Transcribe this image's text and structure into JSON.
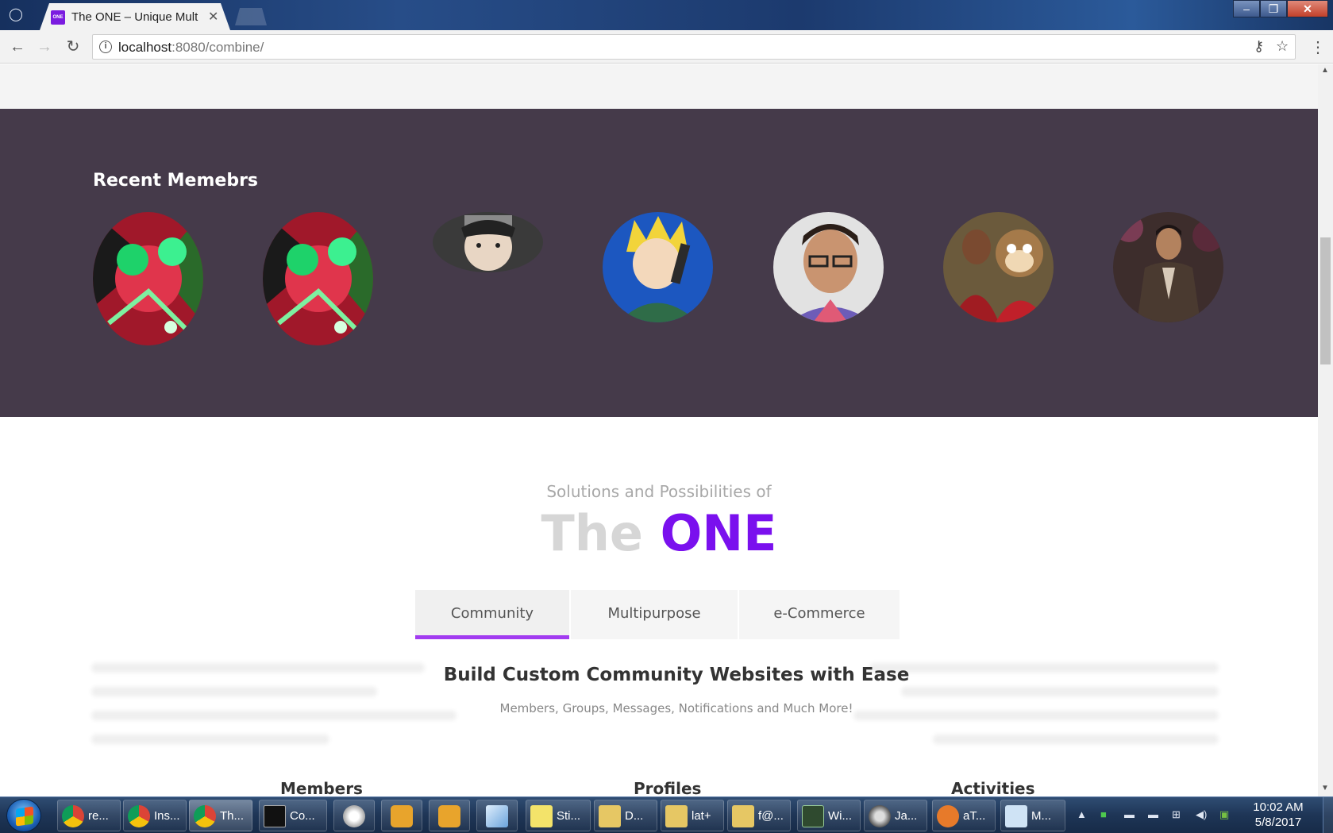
{
  "browser": {
    "tab_title": "The ONE – Unique Multip",
    "favicon_text": "ONE",
    "url_host": "localhost",
    "url_path": ":8080/combine/"
  },
  "members_section": {
    "title": "Recent Memebrs",
    "background": "#453a4a"
  },
  "solutions_section": {
    "subtitle": "Solutions and Possibilities of",
    "heading_the": "The",
    "heading_one": "ONE",
    "accent_color": "#7a10ee",
    "tabs": [
      {
        "label": "Community",
        "active": true
      },
      {
        "label": "Multipurpose",
        "active": false
      },
      {
        "label": "e-Commerce",
        "active": false
      }
    ],
    "feature_title": "Build Custom Community Websites with Ease",
    "feature_subtitle": "Members, Groups, Messages, Notifications and Much More!",
    "columns": [
      "Members",
      "Profiles",
      "Activities"
    ]
  },
  "taskbar": {
    "items": [
      {
        "label": "re...",
        "icon": "chrome-icon"
      },
      {
        "label": "Ins...",
        "icon": "chrome-icon"
      },
      {
        "label": "Th...",
        "icon": "chrome-icon",
        "active": true
      },
      {
        "label": "Co...",
        "icon": "cmd-icon"
      },
      {
        "label": "",
        "icon": "compass-icon"
      },
      {
        "label": "",
        "icon": "sublime-icon"
      },
      {
        "label": "",
        "icon": "sublime-icon"
      },
      {
        "label": "",
        "icon": "cube-icon"
      },
      {
        "label": "Sti...",
        "icon": "sticky-notes-icon"
      },
      {
        "label": "D...",
        "icon": "folder-icon"
      },
      {
        "label": "lat+",
        "icon": "folder-icon"
      },
      {
        "label": "f@...",
        "icon": "folder-icon"
      },
      {
        "label": "Wi...",
        "icon": "terminal-icon"
      },
      {
        "label": "Ja...",
        "icon": "java-gear-icon"
      },
      {
        "label": "aT...",
        "icon": "paw-icon"
      },
      {
        "label": "M...",
        "icon": "mysql-workbench-icon"
      }
    ],
    "clock_time": "10:02 AM",
    "clock_date": "5/8/2017"
  }
}
